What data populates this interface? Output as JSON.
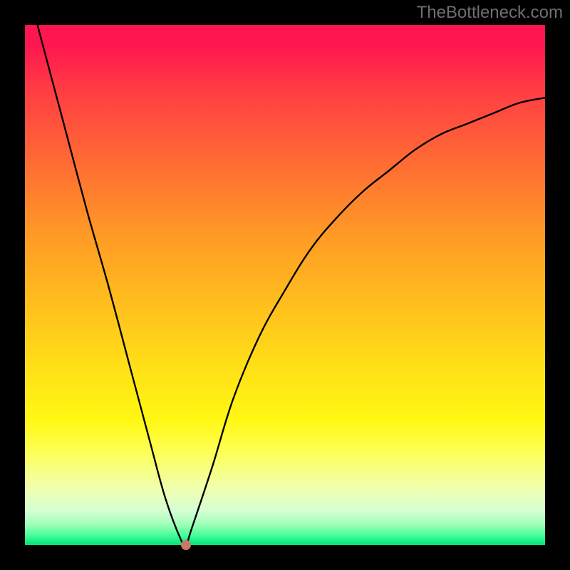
{
  "watermark": "TheBottleneck.com",
  "chart_data": {
    "type": "line",
    "title": "",
    "xlabel": "",
    "ylabel": "",
    "xlim": [
      0,
      100
    ],
    "ylim": [
      0,
      100
    ],
    "grid": false,
    "legend": false,
    "colors": {
      "gradient_top": "#ff1650",
      "gradient_bottom": "#00e27a",
      "curve": "#000000",
      "marker": "#cc7766",
      "frame": "#000000"
    },
    "series": [
      {
        "name": "bottleneck-curve",
        "x": [
          0,
          4,
          8,
          12,
          16,
          20,
          24,
          27,
          30,
          31,
          32,
          36,
          40,
          45,
          50,
          55,
          60,
          65,
          70,
          75,
          80,
          85,
          90,
          95,
          100
        ],
        "values": [
          109,
          94,
          79,
          64,
          50,
          35,
          20,
          9,
          1,
          0,
          3,
          15,
          28,
          40,
          49,
          57,
          63,
          68,
          72,
          76,
          79,
          81,
          83,
          85,
          86
        ]
      }
    ],
    "marker": {
      "x": 31,
      "y": 0
    }
  }
}
